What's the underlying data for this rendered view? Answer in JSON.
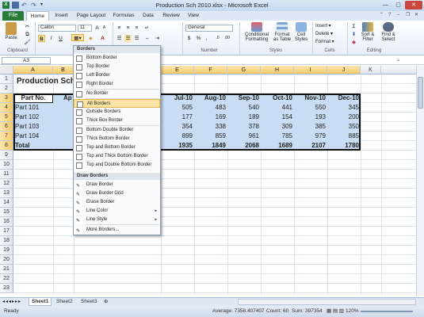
{
  "window": {
    "title": "Production Sch 2010.xlsx - Microsoft Excel"
  },
  "tabs": {
    "file": "File",
    "home": "Home",
    "insert": "Insert",
    "page_layout": "Page Layout",
    "formulas": "Formulas",
    "data": "Data",
    "review": "Review",
    "view": "View"
  },
  "ribbon": {
    "clipboard": {
      "label": "Clipboard",
      "paste": "Paste"
    },
    "font": {
      "name": "Calibri",
      "size": "11",
      "bold": "B",
      "italic": "I",
      "underline": "U"
    },
    "number": {
      "label": "Number",
      "format": "General",
      "currency": "$",
      "percent": "%",
      "comma": ","
    },
    "styles": {
      "label": "Styles",
      "conditional": "Conditional Formatting",
      "as_table": "Format as Table",
      "cell_styles": "Cell Styles"
    },
    "cells": {
      "label": "Cells",
      "insert": "Insert",
      "delete": "Delete",
      "format": "Format"
    },
    "editing": {
      "label": "Editing",
      "sort": "Sort & Filter",
      "find": "Find & Select"
    }
  },
  "namebox": "A3",
  "columns": [
    "A",
    "B",
    "C",
    "D",
    "E",
    "F",
    "G",
    "H",
    "I",
    "J",
    "K"
  ],
  "rows": [
    "1",
    "2",
    "3",
    "4",
    "5",
    "6",
    "7",
    "8",
    "9",
    "10",
    "11",
    "12",
    "13",
    "14",
    "15",
    "16",
    "17",
    "18",
    "19",
    "20",
    "21",
    "22",
    "23"
  ],
  "sheet": {
    "title": "Production Sch",
    "header": {
      "part": "Part No.",
      "partial": "Ap",
      "months": [
        "Jul-10",
        "Aug-10",
        "Sep-10",
        "Oct-10",
        "Nov-10",
        "Dec-10"
      ]
    },
    "parts": [
      {
        "name": "Part 101",
        "values": [
          "505",
          "483",
          "540",
          "441",
          "550",
          "345"
        ]
      },
      {
        "name": "Part 102",
        "values": [
          "177",
          "169",
          "189",
          "154",
          "193",
          "200"
        ]
      },
      {
        "name": "Part 103",
        "values": [
          "354",
          "338",
          "378",
          "309",
          "385",
          "350"
        ]
      },
      {
        "name": "Part 104",
        "values": [
          "899",
          "859",
          "961",
          "785",
          "979",
          "885"
        ]
      }
    ],
    "total": {
      "name": "Total",
      "values": [
        "1935",
        "1849",
        "2068",
        "1689",
        "2107",
        "1780"
      ]
    }
  },
  "borders_menu": {
    "header1": "Borders",
    "items1": [
      "Bottom Border",
      "Top Border",
      "Left Border",
      "Right Border",
      "No Border",
      "All Borders",
      "Outside Borders",
      "Thick Box Border",
      "Bottom Double Border",
      "Thick Bottom Border",
      "Top and Bottom Border",
      "Top and Thick Bottom Border",
      "Top and Double Bottom Border"
    ],
    "header2": "Draw Borders",
    "items2": [
      "Draw Border",
      "Draw Border Grid",
      "Erase Border",
      "Line Color",
      "Line Style",
      "More Borders..."
    ]
  },
  "sheets": [
    "Sheet1",
    "Sheet2",
    "Sheet3"
  ],
  "status": {
    "ready": "Ready",
    "average": "Average: 7358.407407",
    "count": "Count: 60",
    "sum": "Sum: 397354",
    "zoom": "120%"
  }
}
